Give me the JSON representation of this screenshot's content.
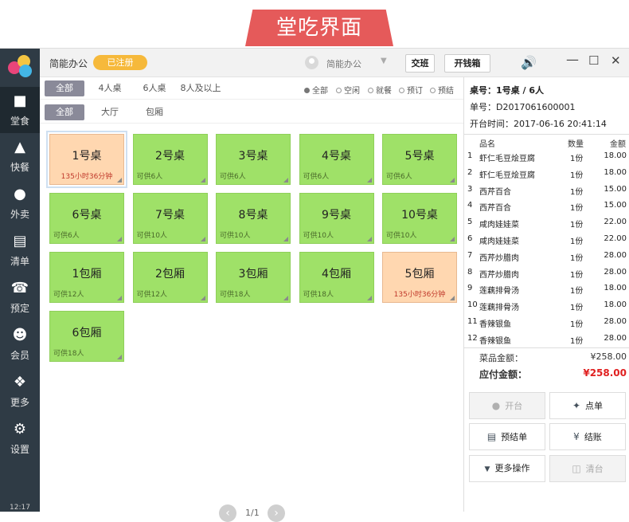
{
  "banner": {
    "title": "堂吃界面"
  },
  "topbar": {
    "shop_name": "简能办公",
    "register_badge": "已注册",
    "user_name": "简能办公",
    "handover_btn": "交班",
    "cashbox_btn": "开钱箱"
  },
  "sidebar": {
    "items": [
      {
        "label": "堂食",
        "icon": "dine-in-icon"
      },
      {
        "label": "快餐",
        "icon": "fastfood-icon"
      },
      {
        "label": "外卖",
        "icon": "delivery-icon"
      },
      {
        "label": "清单",
        "icon": "list-icon"
      },
      {
        "label": "预定",
        "icon": "phone-icon"
      },
      {
        "label": "会员",
        "icon": "member-icon"
      },
      {
        "label": "更多",
        "icon": "more-icon"
      },
      {
        "label": "设置",
        "icon": "settings-icon"
      }
    ],
    "clock": "12:17"
  },
  "filters": {
    "capacity": [
      "全部",
      "4人桌",
      "6人桌",
      "8人及以上"
    ],
    "status": [
      "全部",
      "空闲",
      "就餐",
      "预订",
      "预结"
    ],
    "area": [
      "全部",
      "大厅",
      "包厢"
    ]
  },
  "tables": [
    {
      "name": "1号桌",
      "info": "135小时36分钟",
      "busy": true
    },
    {
      "name": "2号桌",
      "info": "可供6人",
      "busy": false
    },
    {
      "name": "3号桌",
      "info": "可供6人",
      "busy": false
    },
    {
      "name": "4号桌",
      "info": "可供6人",
      "busy": false
    },
    {
      "name": "5号桌",
      "info": "可供6人",
      "busy": false
    },
    {
      "name": "6号桌",
      "info": "可供6人",
      "busy": false
    },
    {
      "name": "7号桌",
      "info": "可供10人",
      "busy": false
    },
    {
      "name": "8号桌",
      "info": "可供10人",
      "busy": false
    },
    {
      "name": "9号桌",
      "info": "可供10人",
      "busy": false
    },
    {
      "name": "10号桌",
      "info": "可供10人",
      "busy": false
    },
    {
      "name": "1包厢",
      "info": "可供12人",
      "busy": false
    },
    {
      "name": "2包厢",
      "info": "可供12人",
      "busy": false
    },
    {
      "name": "3包厢",
      "info": "可供18人",
      "busy": false
    },
    {
      "name": "4包厢",
      "info": "可供18人",
      "busy": false
    },
    {
      "name": "5包厢",
      "info": "135小时36分钟",
      "busy": true
    },
    {
      "name": "6包厢",
      "info": "可供18人",
      "busy": false
    }
  ],
  "pager": {
    "text": "1/1"
  },
  "order": {
    "table_line": "桌号：1号桌 / 6人",
    "order_no": "单号：D2017061600001",
    "open_time": "开台时间：2017-06-16 20:41:14",
    "headers": {
      "name": "品名",
      "qty": "数量",
      "amount": "金额"
    },
    "items": [
      {
        "no": "1",
        "name": "虾仁毛豆烩豆腐",
        "qty": "1份",
        "amount": "18.00"
      },
      {
        "no": "2",
        "name": "虾仁毛豆烩豆腐",
        "qty": "1份",
        "amount": "18.00"
      },
      {
        "no": "3",
        "name": "西芹百合",
        "qty": "1份",
        "amount": "15.00"
      },
      {
        "no": "4",
        "name": "西芹百合",
        "qty": "1份",
        "amount": "15.00"
      },
      {
        "no": "5",
        "name": "咸肉娃娃菜",
        "qty": "1份",
        "amount": "22.00"
      },
      {
        "no": "6",
        "name": "咸肉娃娃菜",
        "qty": "1份",
        "amount": "22.00"
      },
      {
        "no": "7",
        "name": "西芹炒腊肉",
        "qty": "1份",
        "amount": "28.00"
      },
      {
        "no": "8",
        "name": "西芹炒腊肉",
        "qty": "1份",
        "amount": "28.00"
      },
      {
        "no": "9",
        "name": "莲藕排骨汤",
        "qty": "1份",
        "amount": "18.00"
      },
      {
        "no": "10",
        "name": "莲藕排骨汤",
        "qty": "1份",
        "amount": "18.00"
      },
      {
        "no": "11",
        "name": "香辣银鱼",
        "qty": "1份",
        "amount": "28.00"
      },
      {
        "no": "12",
        "name": "香辣银鱼",
        "qty": "1份",
        "amount": "28.00"
      }
    ],
    "dish_total_label": "菜品金额：",
    "dish_total": "¥258.00",
    "payable_label": "应付金额：",
    "payable": "¥258.00",
    "actions": {
      "open": "开台",
      "order": "点单",
      "prebill": "预结单",
      "checkout": "结账",
      "more": "更多操作",
      "clear": "清台"
    }
  }
}
